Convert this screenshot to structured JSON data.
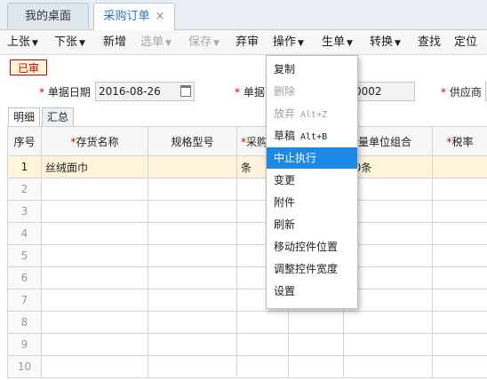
{
  "tabs": [
    {
      "label": "我的桌面"
    },
    {
      "label": "采购订单",
      "close": "×"
    }
  ],
  "toolbar": {
    "items": [
      {
        "label": "上张",
        "caret": "▼"
      },
      {
        "label": "下张",
        "caret": "▼"
      },
      {
        "label": "新增"
      },
      {
        "label": "选单",
        "caret": "▼"
      },
      {
        "label": "保存",
        "caret": "▼"
      },
      {
        "label": "弃审"
      },
      {
        "label": "操作",
        "caret": "▼"
      },
      {
        "label": "生单",
        "caret": "▼"
      },
      {
        "label": "转换",
        "caret": "▼"
      },
      {
        "label": "查找"
      },
      {
        "label": "定位"
      }
    ]
  },
  "status_stamp": "已审",
  "header_fields": {
    "doc_date_label": "单据日期",
    "doc_date_value": "2016-08-26",
    "doc_no_label": "单据",
    "doc_no_value": "0002",
    "supplier_label": "供应商",
    "required_mark": "*"
  },
  "sub_tabs": [
    "明细",
    "汇总"
  ],
  "grid": {
    "columns": [
      "序号",
      "存货名称",
      "规格型号",
      "采购",
      "",
      "计量单位组合",
      "税率"
    ],
    "required_columns": [
      1,
      3,
      6
    ],
    "rows": [
      {
        "no": "1",
        "cells": [
          "丝绒面巾",
          "",
          "条",
          "",
          "00条",
          ""
        ]
      },
      {
        "no": "2"
      },
      {
        "no": "3"
      },
      {
        "no": "4"
      },
      {
        "no": "5"
      },
      {
        "no": "6"
      },
      {
        "no": "7"
      },
      {
        "no": "8"
      },
      {
        "no": "9"
      },
      {
        "no": "10"
      }
    ]
  },
  "context_menu": {
    "items": [
      {
        "label": "复制",
        "disabled": false
      },
      {
        "label": "删除",
        "disabled": true
      },
      {
        "label": "放弃",
        "shortcut": "Alt+Z",
        "disabled": true
      },
      {
        "label": "草稿",
        "shortcut": "Alt+B",
        "disabled": false
      },
      {
        "label": "中止执行",
        "highlighted": true
      },
      {
        "label": "变更"
      },
      {
        "label": "附件"
      },
      {
        "label": "刷新"
      },
      {
        "label": "移动控件位置"
      },
      {
        "label": "调整控件宽度"
      },
      {
        "label": "设置"
      }
    ]
  },
  "colors": {
    "accent": "#1e88e5",
    "stamp_red": "#cc0000",
    "selected_row": "#fff3dc"
  }
}
